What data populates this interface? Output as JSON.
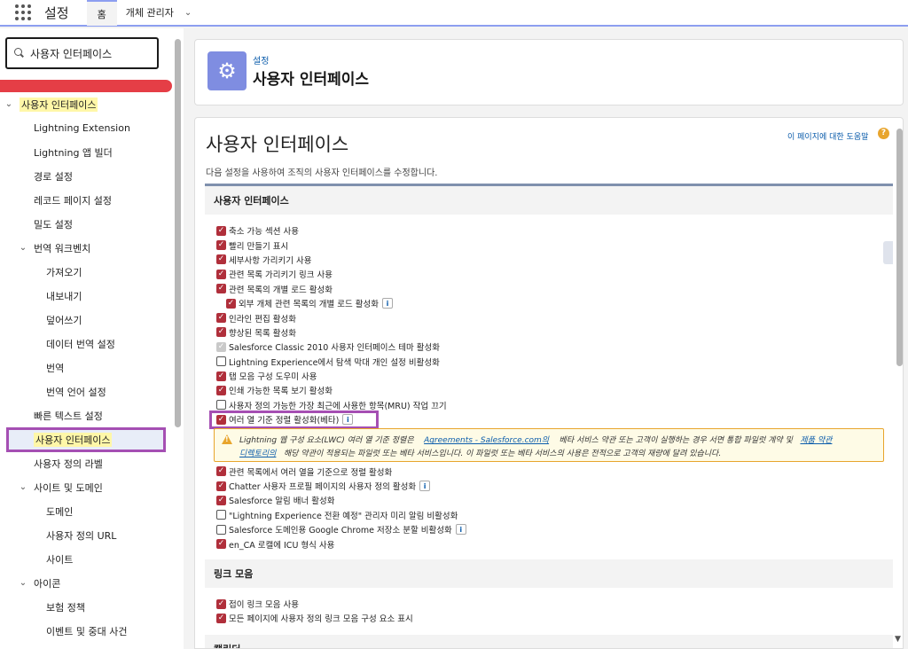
{
  "topbar": {
    "app_name": "설정",
    "tab_home": "홈",
    "tab_object_manager": "개체 관리자"
  },
  "sidebar": {
    "search_value": "사용자 인터페이스",
    "items": [
      {
        "label": "사용자 인터페이스",
        "level": 0,
        "chevron": "⌄",
        "highlight": true
      },
      {
        "label": "Lightning Extension",
        "level": 1
      },
      {
        "label": "Lightning 앱 빌더",
        "level": 1
      },
      {
        "label": "경로 설정",
        "level": 1
      },
      {
        "label": "레코드 페이지 설정",
        "level": 1
      },
      {
        "label": "밀도 설정",
        "level": 1
      },
      {
        "label": "번역 워크벤치",
        "level": 1,
        "chevron": "⌄"
      },
      {
        "label": "가져오기",
        "level": 2
      },
      {
        "label": "내보내기",
        "level": 2
      },
      {
        "label": "덮어쓰기",
        "level": 2
      },
      {
        "label": "데이터 번역 설정",
        "level": 2
      },
      {
        "label": "번역",
        "level": 2
      },
      {
        "label": "번역 언어 설정",
        "level": 2
      },
      {
        "label": "빠른 텍스트 설정",
        "level": 1
      },
      {
        "label": "사용자 인터페이스",
        "level": 1,
        "active": true
      },
      {
        "label": "사용자 정의 라벨",
        "level": 1
      },
      {
        "label": "사이트 및 도메인",
        "level": 1,
        "chevron": "⌄"
      },
      {
        "label": "도메인",
        "level": 2
      },
      {
        "label": "사용자 정의 URL",
        "level": 2
      },
      {
        "label": "사이트",
        "level": 2
      },
      {
        "label": "아이콘",
        "level": 1,
        "chevron": "⌄"
      },
      {
        "label": "보험 정책",
        "level": 2
      },
      {
        "label": "이벤트 및 중대 사건",
        "level": 2
      }
    ]
  },
  "header": {
    "breadcrumb": "설정",
    "title": "사용자 인터페이스",
    "icon": "gear-icon"
  },
  "main": {
    "title": "사용자 인터페이스",
    "help_link": "이 페이지에 대한 도움말",
    "description": "다음 설정을 사용하여 조직의 사용자 인터페이스를 수정합니다.",
    "section_ui": {
      "heading": "사용자 인터페이스",
      "options": [
        {
          "label": "축소 가능 섹션 사용",
          "state": "checked"
        },
        {
          "label": "빨리 만들기 표시",
          "state": "checked"
        },
        {
          "label": "세부사항 가리키기 사용",
          "state": "checked"
        },
        {
          "label": "관련 목록 가리키기 링크 사용",
          "state": "checked"
        },
        {
          "label": "관련 목록의 개별 로드 활성화",
          "state": "checked"
        },
        {
          "label": "외부 개체 관련 목록의 개별 로드 활성화",
          "state": "checked",
          "indent": true,
          "info": true
        },
        {
          "label": "인라인 편집 활성화",
          "state": "checked"
        },
        {
          "label": "향상된 목록 활성화",
          "state": "checked"
        },
        {
          "label": "Salesforce Classic 2010 사용자 인터페이스 테마 활성화",
          "state": "disabled"
        },
        {
          "label": "Lightning Experience에서 탐색 막대 개인 설정 비활성화",
          "state": "unchecked"
        },
        {
          "label": "탭 모음 구성 도우미 사용",
          "state": "checked"
        },
        {
          "label": "인쇄 가능한 목록 보기 활성화",
          "state": "checked"
        },
        {
          "label": "사용자 정의 가능한 가장 최근에 사용한 항목(MRU) 작업 끄기",
          "state": "unchecked"
        },
        {
          "label": "여러 열 기준 정렬 활성화(베타)",
          "state": "checked",
          "info": true,
          "boxed": true
        }
      ],
      "warning": {
        "line1_a": "Lightning 웹 구성 요소(LWC) 여러 열 기준 정렬은",
        "line1_link1": "Agreements - Salesforce.com의",
        "line1_b": "베타 서비스 약관 또는 고객이 실행하는 경우 서면 통합 파일럿 계약 및",
        "line1_link2": "제품 약관",
        "line2_link": "디렉토리의",
        "line2_b": "해당 약관이 적용되는 파일럿 또는 베타 서비스입니다. 이 파일럿 또는 베타 서비스의 사용은 전적으로 고객의 재량에 달려 있습니다."
      },
      "options2": [
        {
          "label": "관련 목록에서 여러 열을 기준으로 정렬 활성화",
          "state": "checked"
        },
        {
          "label": "Chatter 사용자 프로필 페이지의 사용자 정의 활성화",
          "state": "checked",
          "info": true
        },
        {
          "label": "Salesforce 알림 배너 활성화",
          "state": "checked"
        },
        {
          "label": "\"Lightning Experience 전환 예정\" 관리자 미리 알림 비활성화",
          "state": "unchecked"
        },
        {
          "label": "Salesforce 도메인용 Google Chrome 저장소 분할 비활성화",
          "state": "unchecked",
          "info": true
        },
        {
          "label": "en_CA 로캘에 ICU 형식 사용",
          "state": "checked"
        }
      ]
    },
    "section_links": {
      "heading": "링크 모음",
      "options": [
        {
          "label": "접이 링크 모음 사용",
          "state": "checked"
        },
        {
          "label": "모든 페이지에 사용자 정의 링크 모음 구성 요소 표시",
          "state": "checked"
        }
      ]
    },
    "section_calendar": {
      "heading": "캘린더"
    }
  }
}
